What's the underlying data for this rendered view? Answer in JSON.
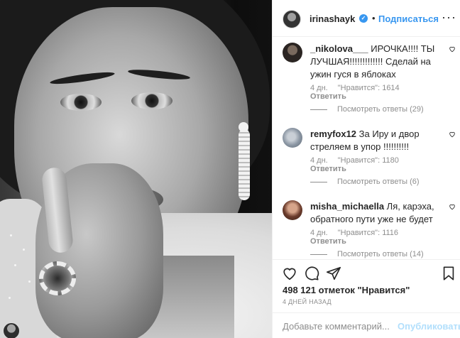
{
  "header": {
    "username": "irinashayk",
    "verified_glyph": "✓",
    "separator": "•",
    "follow_label": "Подписаться",
    "more_label": "···"
  },
  "comments": [
    {
      "user": "_nikolova___",
      "text": " ИРОЧКА!!!! ТЫ ЛУЧШАЯ!!!!!!!!!!!!! Сделай на ужин гуся в яблоках",
      "age": "4 дн.",
      "likes": "\"Нравится\": 1614",
      "reply": "Ответить",
      "view_replies": "Посмотреть ответы (29)"
    },
    {
      "user": "remyfox12",
      "text": " За Иру и двор стреляем в упор !!!!!!!!!!",
      "age": "4 дн.",
      "likes": "\"Нравится\": 1180",
      "reply": "Ответить",
      "view_replies": "Посмотреть ответы (6)"
    },
    {
      "user": "misha_michaella",
      "text": " Ля, карэха, обратного пути уже не будет",
      "age": "4 дн.",
      "likes": "\"Нравится\": 1116",
      "reply": "Ответить",
      "view_replies": "Посмотреть ответы (14)"
    }
  ],
  "actions": {
    "like_icon": "heart-outline-icon",
    "comment_icon": "comment-bubble-icon",
    "share_icon": "paper-plane-icon",
    "save_icon": "bookmark-icon"
  },
  "likes_text": "498 121 отметок \"Нравится\"",
  "date_text": "4 ДНЕЙ НАЗАД",
  "add_comment": {
    "placeholder": "Добавьте комментарий...",
    "post_label": "Опубликовать"
  },
  "colors": {
    "link_blue": "#3897f0",
    "disabled_blue": "#b2dffc",
    "muted_text": "#8e8e8e",
    "text": "#262626"
  }
}
